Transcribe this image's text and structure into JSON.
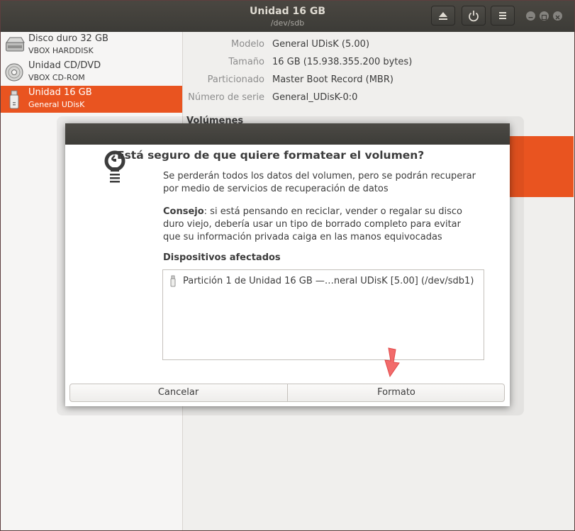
{
  "window": {
    "title": "Unidad 16 GB",
    "subtitle": "/dev/sdb"
  },
  "headerbar": {
    "eject_icon": "eject-icon",
    "power_icon": "power-icon",
    "menu_icon": "hamburger-menu-icon"
  },
  "sidebar": {
    "items": [
      {
        "title": "Disco duro 32 GB",
        "subtitle": "VBOX HARDDISK",
        "icon": "harddisk-icon",
        "selected": false
      },
      {
        "title": "Unidad CD/DVD",
        "subtitle": "VBOX CD-ROM",
        "icon": "optical-disc-icon",
        "selected": false
      },
      {
        "title": "Unidad 16 GB",
        "subtitle": "General UDisK",
        "icon": "usb-drive-icon",
        "selected": true
      }
    ]
  },
  "properties": [
    {
      "label": "Modelo",
      "value": "General UDisK (5.00)"
    },
    {
      "label": "Tamaño",
      "value": "16 GB (15.938.355.200 bytes)"
    },
    {
      "label": "Particionado",
      "value": "Master Boot Record (MBR)"
    },
    {
      "label": "Número de serie",
      "value": "General_UDisK-0:0"
    }
  ],
  "volumes_heading": "Volúmenes",
  "dialog": {
    "heading": "¿Está seguro de que quiere formatear el volumen?",
    "line1": "Se perderán todos los datos del volumen, pero se podrán recuperar",
    "line2": "por medio de servicios de recuperación de datos",
    "tip_bold": "Consejo",
    "tip_line1_rest": ": si está pensando en reciclar, vender o regalar su disco",
    "tip_line2": "duro viejo, debería usar un tipo de borrado completo para evitar",
    "tip_line3": "que su información privada caiga en las manos equivocadas",
    "affected_label": "Dispositivos afectados",
    "affected_devices": [
      {
        "label": "Partición 1 de Unidad 16 GB —…neral UDisK [5.00] (/dev/sdb1)",
        "icon": "usb-drive-icon"
      }
    ],
    "cancel_label": "Cancelar",
    "format_label": "Formato"
  },
  "colors": {
    "accent": "#e95420",
    "titlebar": "#3c3b37",
    "arrow": "#f26b6b"
  }
}
